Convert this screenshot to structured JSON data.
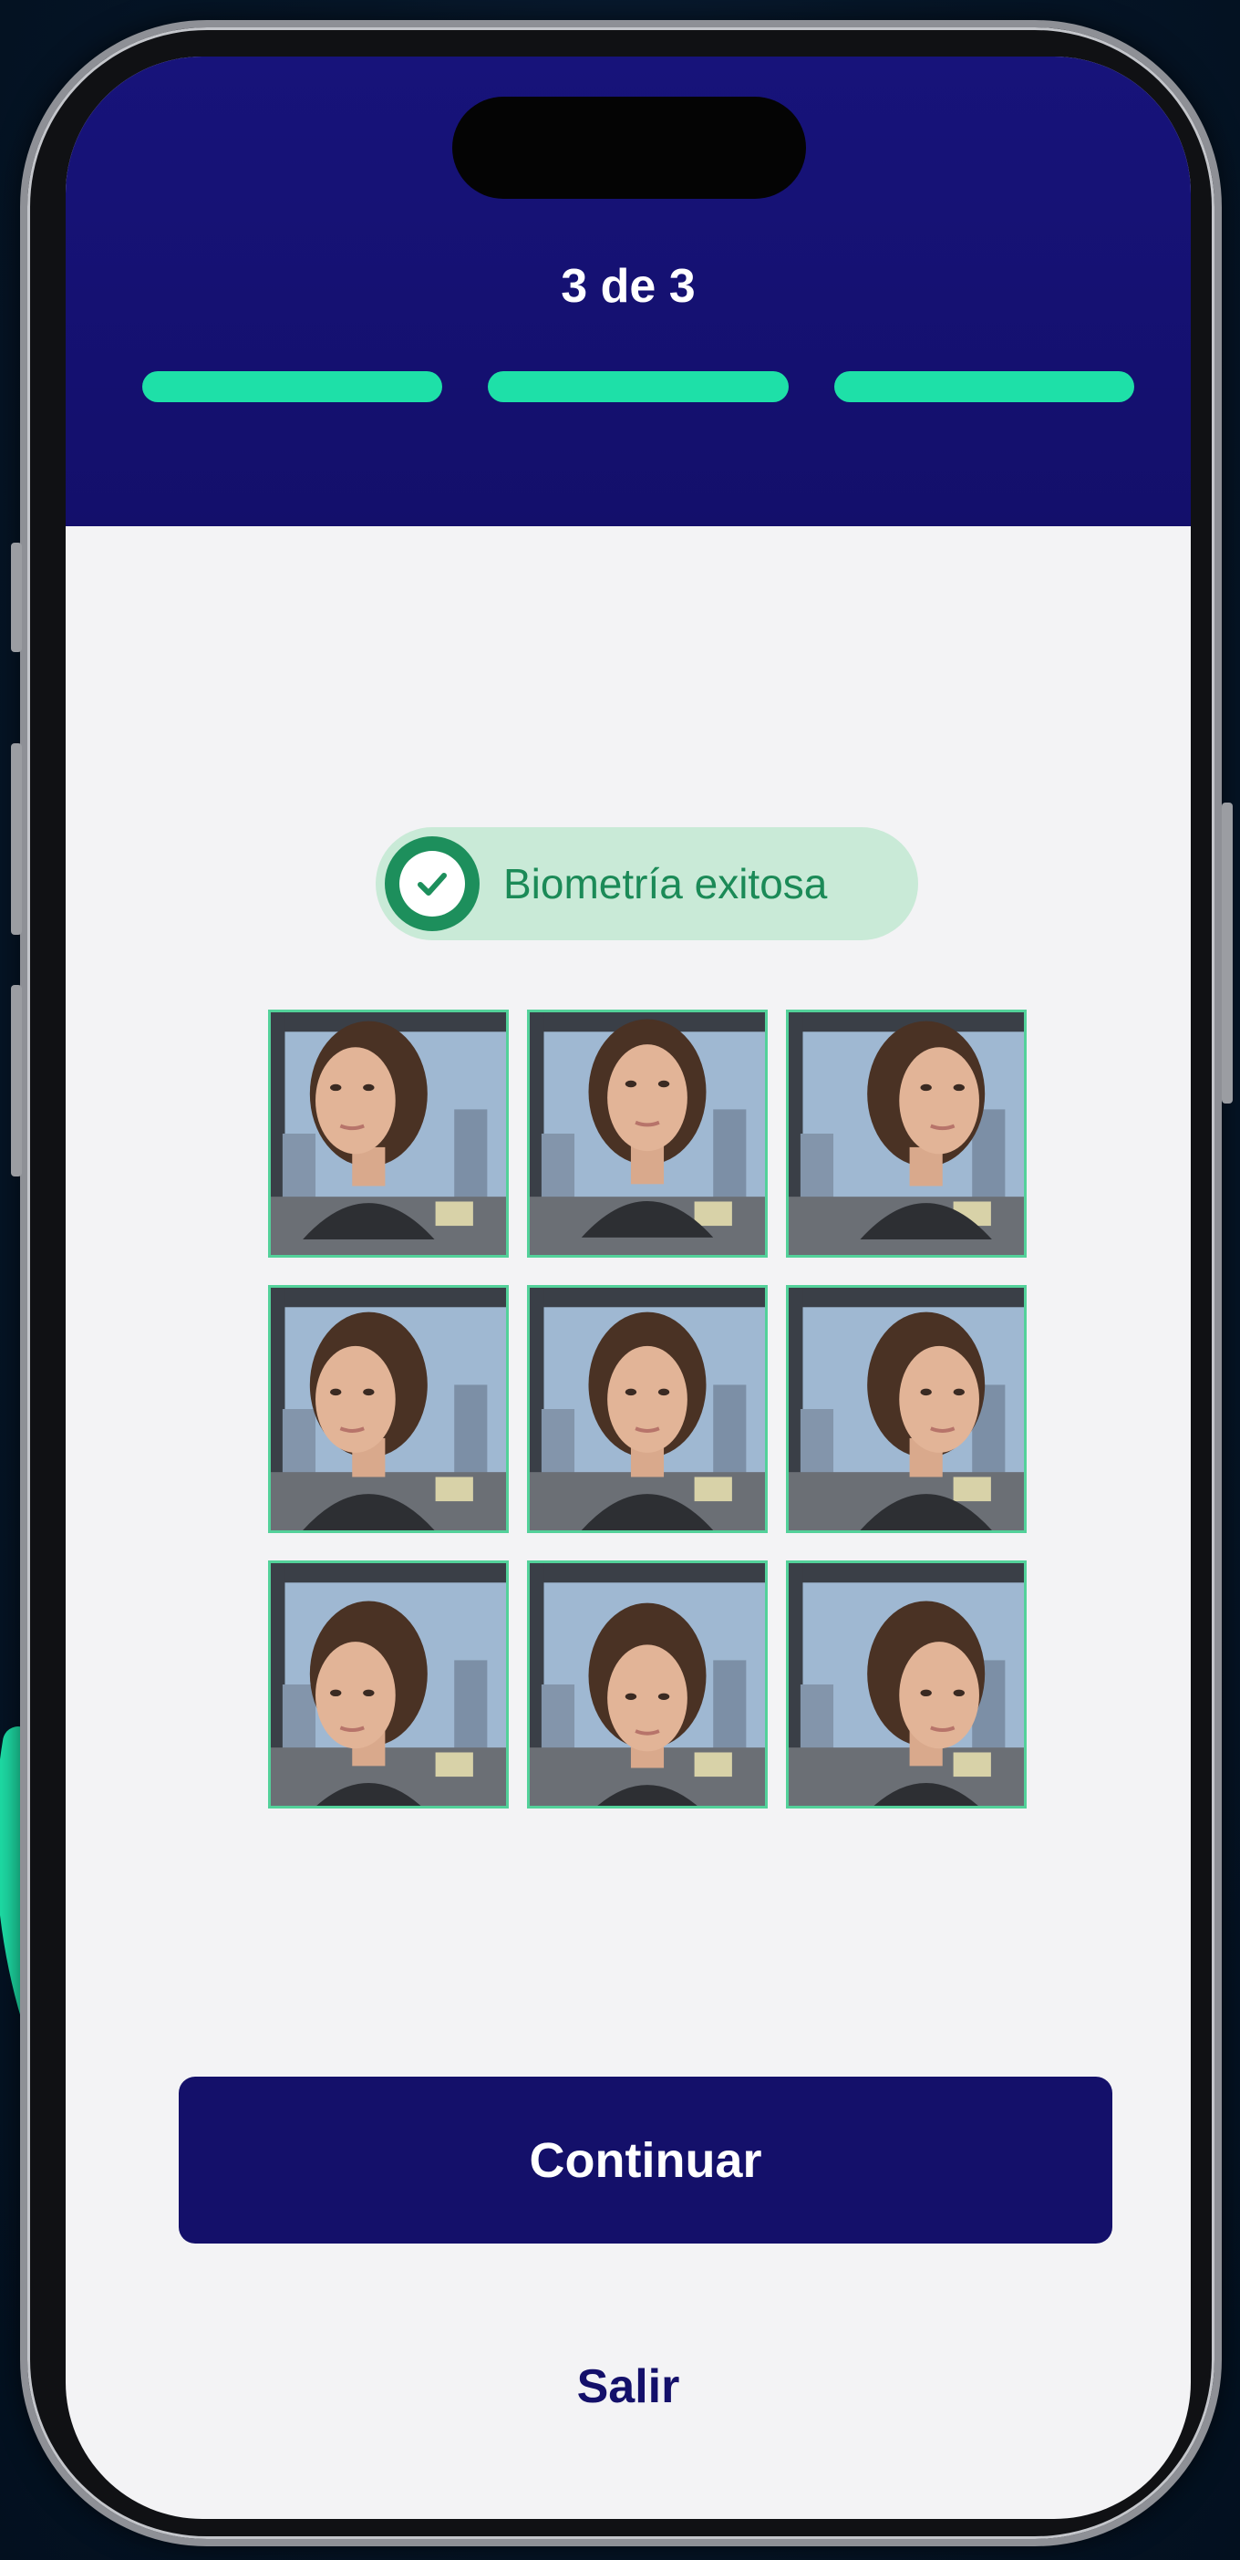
{
  "header": {
    "step_label": "3 de 3",
    "progress": {
      "completed_steps": 3,
      "total_steps": 3
    }
  },
  "status": {
    "label": "Biometría exitosa",
    "icon": "check-circle-icon",
    "color": "#1b8a57"
  },
  "captures": [
    {
      "pose": "up-left"
    },
    {
      "pose": "up"
    },
    {
      "pose": "up-right"
    },
    {
      "pose": "left"
    },
    {
      "pose": "center"
    },
    {
      "pose": "right"
    },
    {
      "pose": "down-left"
    },
    {
      "pose": "down"
    },
    {
      "pose": "down-right"
    }
  ],
  "actions": {
    "continue_label": "Continuar",
    "exit_label": "Salir"
  },
  "colors": {
    "header": "#17137a",
    "accent": "#1ee0a8",
    "primary_button": "#14106a",
    "tile_border": "#53d19a"
  }
}
